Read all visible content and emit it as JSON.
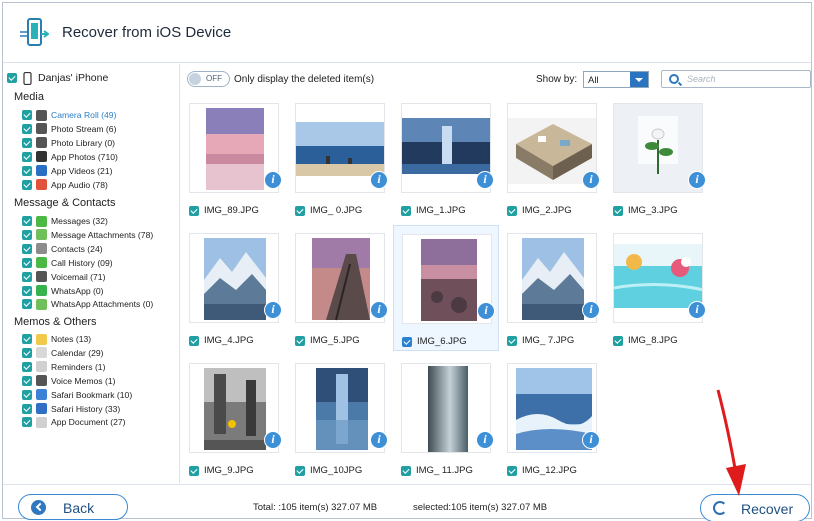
{
  "window": {
    "title": "Recover from iOS Device"
  },
  "sidebar": {
    "device": "Danjas' iPhone",
    "sections": [
      {
        "title": "Media",
        "items": [
          {
            "label": "Camera Roll (49)",
            "icon": "camera-icon",
            "color": "#555555",
            "active": true
          },
          {
            "label": "Photo Stream (6)",
            "icon": "photo-stream-icon",
            "color": "#555555"
          },
          {
            "label": "Photo Library (0)",
            "icon": "photo-library-icon",
            "color": "#555555"
          },
          {
            "label": "App Photos (710)",
            "icon": "app-photos-icon",
            "color": "#333333"
          },
          {
            "label": "App Videos (21)",
            "icon": "app-videos-icon",
            "color": "#2a6fc4"
          },
          {
            "label": "App Audio (78)",
            "icon": "app-audio-icon",
            "color": "#e0523a"
          }
        ]
      },
      {
        "title": "Message & Contacts",
        "items": [
          {
            "label": "Messages (32)",
            "icon": "messages-icon",
            "color": "#4cb944"
          },
          {
            "label": "Message Attachments (78)",
            "icon": "attachment-icon",
            "color": "#6fbf5a"
          },
          {
            "label": "Contacts (24)",
            "icon": "contacts-icon",
            "color": "#8c8c8c"
          },
          {
            "label": "Call History (09)",
            "icon": "phone-icon",
            "color": "#4cb944"
          },
          {
            "label": "Voicemail (71)",
            "icon": "voicemail-icon",
            "color": "#555555"
          },
          {
            "label": "WhatsApp (0)",
            "icon": "whatsapp-icon",
            "color": "#37b24d"
          },
          {
            "label": "WhatsApp Attachments (0)",
            "icon": "whatsapp-attachment-icon",
            "color": "#6fbf5a"
          }
        ]
      },
      {
        "title": "Memos & Others",
        "items": [
          {
            "label": "Notes (13)",
            "icon": "notes-icon",
            "color": "#f2c94c"
          },
          {
            "label": "Calendar (29)",
            "icon": "calendar-icon",
            "color": "#d8d8d8"
          },
          {
            "label": "Reminders (1)",
            "icon": "reminders-icon",
            "color": "#d0d0d0"
          },
          {
            "label": "Voice Memos (1)",
            "icon": "voice-memos-icon",
            "color": "#555555"
          },
          {
            "label": "Safari Bookmark (10)",
            "icon": "bookmark-icon",
            "color": "#3b82d6"
          },
          {
            "label": "Safari History (33)",
            "icon": "safari-icon",
            "color": "#2f6fc4"
          },
          {
            "label": "App Document (27)",
            "icon": "document-icon",
            "color": "#d0d0d0"
          }
        ]
      }
    ]
  },
  "toolbar": {
    "toggle_state": "OFF",
    "deleted_only_label": "Only display the deleted item(s)",
    "show_by_label": "Show by:",
    "show_by_value": "All",
    "search_placeholder": "Search"
  },
  "photos": [
    {
      "name": "IMG_89.JPG",
      "scene": "sunset"
    },
    {
      "name": "IMG_ 0.JPG",
      "scene": "beach"
    },
    {
      "name": "IMG_1.JPG",
      "scene": "sea-dusk"
    },
    {
      "name": "IMG_2.JPG",
      "scene": "floorplan"
    },
    {
      "name": "IMG_3.JPG",
      "scene": "plant"
    },
    {
      "name": "IMG_4.JPG",
      "scene": "mountain"
    },
    {
      "name": "IMG_5.JPG",
      "scene": "pier"
    },
    {
      "name": "IMG_6.JPG",
      "scene": "rocks-sunset",
      "selected": true
    },
    {
      "name": "IMG_ 7.JPG",
      "scene": "mountain"
    },
    {
      "name": "IMG_8.JPG",
      "scene": "pool"
    },
    {
      "name": "IMG_9.JPG",
      "scene": "street"
    },
    {
      "name": "IMG_10JPG",
      "scene": "reflection"
    },
    {
      "name": "IMG_ 11.JPG",
      "scene": "gradient"
    },
    {
      "name": "IMG_12.JPG",
      "scene": "wave"
    }
  ],
  "footer": {
    "back_label": "Back",
    "total_text": "Total: :105 item(s) 327.07 MB",
    "selected_text": "selected:105 item(s) 327.07 MB",
    "recover_label": "Recover"
  }
}
